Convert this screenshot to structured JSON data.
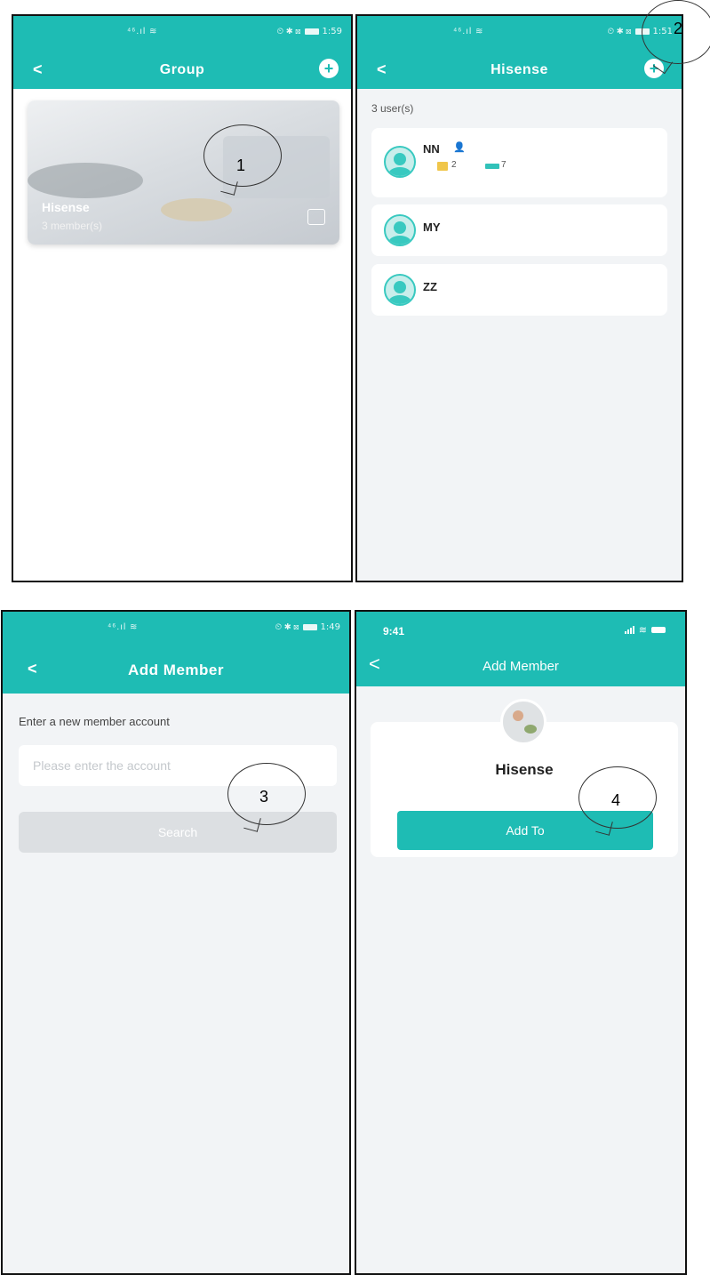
{
  "panel1": {
    "status": {
      "signal": "⁴⁶.ıl ≋",
      "icons": "⏲ ✱ ⊠",
      "time": "1:59"
    },
    "nav": {
      "back": "<",
      "title": "Group",
      "plus": "+"
    },
    "card": {
      "name": "Hisense",
      "members": "3 member(s)"
    }
  },
  "panel2": {
    "status": {
      "signal": "⁴⁶.ıl ≋",
      "icons": "⏲ ✱ ⊠",
      "time": "1:51"
    },
    "nav": {
      "back": "<",
      "title": "Hisense",
      "plus": "+"
    },
    "user_count": "3 user(s)",
    "users": [
      {
        "name": "NN",
        "folders": "2",
        "devices": "7"
      },
      {
        "name": "MY"
      },
      {
        "name": "ZZ"
      }
    ]
  },
  "panel3": {
    "status": {
      "signal": "⁴⁶.ıl ≋",
      "icons": "⏲ ✱ ⊠",
      "time": "1:49"
    },
    "nav": {
      "back": "<",
      "title": "Add Member"
    },
    "label": "Enter a new member account",
    "input_placeholder": "Please enter the account",
    "search_label": "Search"
  },
  "panel4": {
    "status": {
      "time": "9:41"
    },
    "nav": {
      "back": "<",
      "title": "Add Member"
    },
    "group_name": "Hisense",
    "add_label": "Add To"
  },
  "callouts": [
    "1",
    "2",
    "3",
    "4"
  ],
  "colors": {
    "brand": "#1ebcb4",
    "background": "#f2f4f6",
    "folder": "#f0c64a",
    "disabled": "#dcdfe2"
  }
}
